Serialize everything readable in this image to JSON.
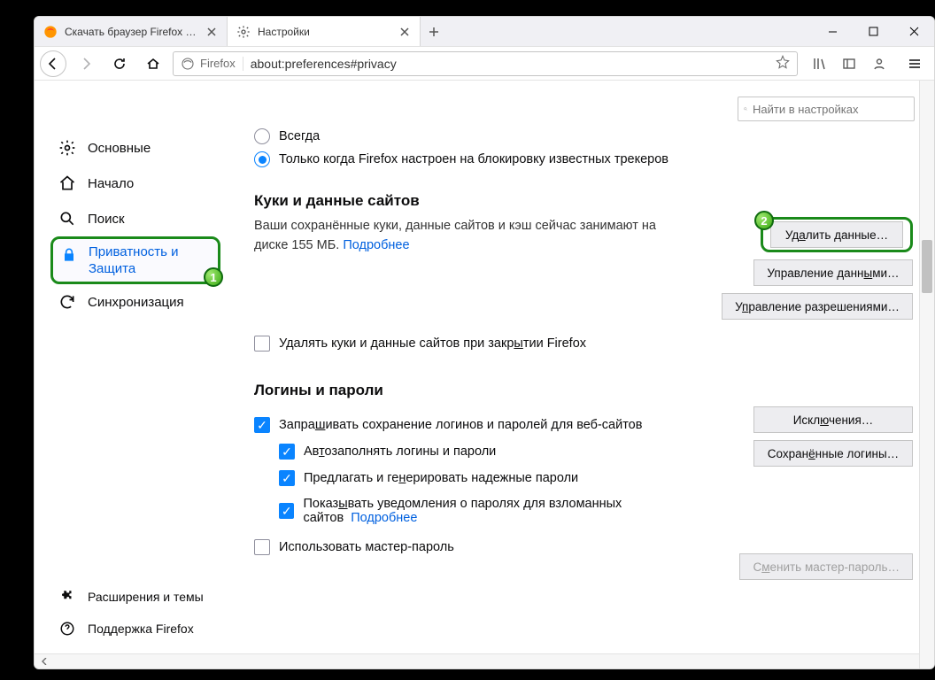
{
  "tabs": [
    {
      "title": "Скачать браузер Firefox для ко",
      "favicon": "firefox"
    },
    {
      "title": "Настройки",
      "favicon": "gear"
    }
  ],
  "newtab_plus": "+",
  "address": {
    "identity_label": "Firefox",
    "url": "about:preferences#privacy"
  },
  "search": {
    "placeholder": "Найти в настройках"
  },
  "sidebar": {
    "items": [
      {
        "key": "general",
        "label": "Основные",
        "icon": "gear"
      },
      {
        "key": "home",
        "label": "Начало",
        "icon": "home"
      },
      {
        "key": "search",
        "label": "Поиск",
        "icon": "search"
      },
      {
        "key": "privacy",
        "label": "Приватность и Защита",
        "icon": "lock"
      },
      {
        "key": "sync",
        "label": "Синхронизация",
        "icon": "sync"
      }
    ],
    "footer": [
      {
        "key": "addons",
        "label": "Расширения и темы",
        "icon": "puzzle"
      },
      {
        "key": "support",
        "label": "Поддержка Firefox",
        "icon": "help"
      }
    ]
  },
  "callouts": {
    "one": "1",
    "two": "2"
  },
  "dnt": {
    "always": "Всегда",
    "only_tracking": "Только когда Firefox настроен на блокировку известных трекеров"
  },
  "cookies": {
    "title": "Куки и данные сайтов",
    "desc_prefix": "Ваши сохранённые куки, данные сайтов и кэш сейчас занимают на диске ",
    "size": "155 МБ",
    "desc_suffix": ".   ",
    "learn_more": "Подробнее",
    "buttons": {
      "clear": "Удалить данные…",
      "manage": "Управление данными…",
      "permissions": "Управление разрешениями…"
    },
    "delete_on_close_prefix": "Удалять куки и данные сайтов при закр",
    "delete_on_close_accel": "ы",
    "delete_on_close_suffix": "тии Firefox"
  },
  "logins": {
    "title": "Логины и пароли",
    "ask_prefix": "Запра",
    "ask_accel": "ш",
    "ask_suffix": "ивать сохранение логинов и паролей для веб-сайтов",
    "autofill_prefix": "Ав",
    "autofill_accel": "т",
    "autofill_suffix": "озаполнять логины и пароли",
    "suggest_prefix": "Предлагать и ге",
    "suggest_accel": "н",
    "suggest_suffix": "ерировать надежные пароли",
    "breach_prefix": "Показ",
    "breach_accel": "ы",
    "breach_suffix": "вать уведомления о паролях для взломанных сайтов",
    "breach_more": "Подробнее",
    "master_label": "Использовать мастер-пароль",
    "buttons": {
      "exceptions_prefix": "Искл",
      "exceptions_accel": "ю",
      "exceptions_suffix": "чения…",
      "saved_prefix": "Сохран",
      "saved_accel": "ё",
      "saved_suffix": "нные логины…",
      "change_master_prefix": "С",
      "change_master_accel": "м",
      "change_master_suffix": "енить мастер-пароль…"
    }
  }
}
